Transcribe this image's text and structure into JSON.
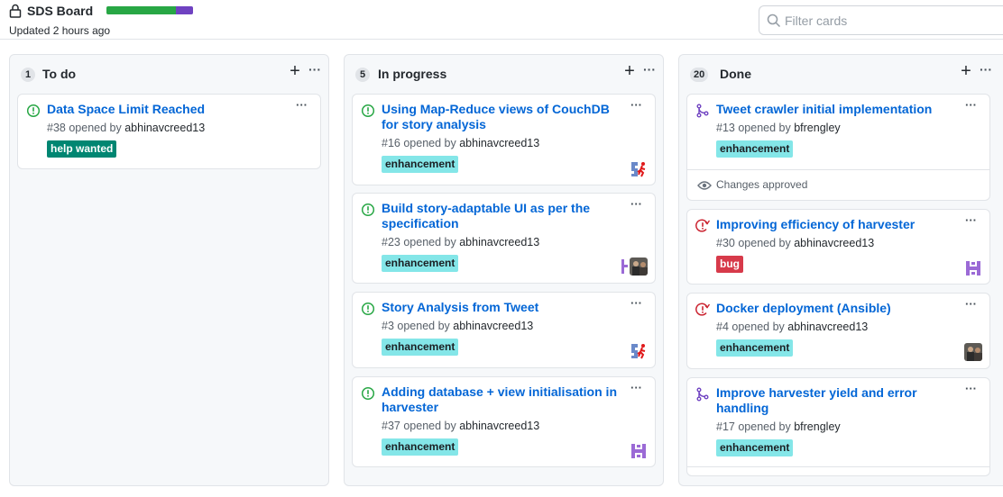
{
  "board": {
    "title": "SDS Board",
    "updated": "Updated 2 hours ago",
    "progress": {
      "done_fraction": 0.8,
      "in_progress_fraction": 0.2,
      "done_color": "#28a745",
      "in_progress_color": "#6f42c1"
    },
    "filter_placeholder": "Filter cards"
  },
  "columns": [
    {
      "count": "1",
      "name": "To do",
      "cards": [
        {
          "title": "Data Space Limit Reached",
          "number": "#38",
          "opened_by": "opened by",
          "author": "abhinavcreed13",
          "label": "help wanted",
          "state": "open-issue"
        }
      ]
    },
    {
      "count": "5",
      "name": "In progress",
      "cards": [
        {
          "title": "Using Map-Reduce views of CouchDB for story analysis",
          "number": "#16",
          "opened_by": "opened by",
          "author": "abhinavcreed13",
          "label": "enhancement",
          "state": "open-issue"
        },
        {
          "title": "Build story-adaptable UI as per the specification",
          "number": "#23",
          "opened_by": "opened by",
          "author": "abhinavcreed13",
          "label": "enhancement",
          "state": "open-issue"
        },
        {
          "title": "Story Analysis from Tweet",
          "number": "#3",
          "opened_by": "opened by",
          "author": "abhinavcreed13",
          "label": "enhancement",
          "state": "open-issue"
        },
        {
          "title": "Adding database + view initialisation in harvester",
          "number": "#37",
          "opened_by": "opened by",
          "author": "abhinavcreed13",
          "label": "enhancement",
          "state": "open-issue"
        }
      ]
    },
    {
      "count": "20",
      "name": "Done",
      "cards": [
        {
          "title": "Tweet crawler initial implementation",
          "number": "#13",
          "opened_by": "opened by",
          "author": "bfrengley",
          "label": "enhancement",
          "state": "merged-pr",
          "review": "Changes approved"
        },
        {
          "title": "Improving efficiency of harvester",
          "number": "#30",
          "opened_by": "opened by",
          "author": "abhinavcreed13",
          "label": "bug",
          "state": "closed-issue"
        },
        {
          "title": "Docker deployment (Ansible)",
          "number": "#4",
          "opened_by": "opened by",
          "author": "abhinavcreed13",
          "label": "enhancement",
          "state": "closed-issue"
        },
        {
          "title": "Improve harvester yield and error handling",
          "number": "#17",
          "opened_by": "opened by",
          "author": "bfrengley",
          "label": "enhancement",
          "state": "merged-pr"
        }
      ]
    }
  ],
  "icons": {
    "lock": "lock-icon",
    "search": "search-icon",
    "open_issue": "issue-opened-icon",
    "closed_issue": "issue-closed-icon",
    "merged_pr": "git-merge-icon",
    "eye": "eye-icon",
    "plus": "plus-icon",
    "more": "kebab-horizontal-icon"
  },
  "colors": {
    "link": "#0366d6",
    "open_green": "#28a745",
    "closed_red": "#cb2431",
    "merged_purple": "#6f42c1",
    "enhancement": "#84e6e8",
    "help_wanted": "#008672",
    "bug": "#d73a4a"
  }
}
